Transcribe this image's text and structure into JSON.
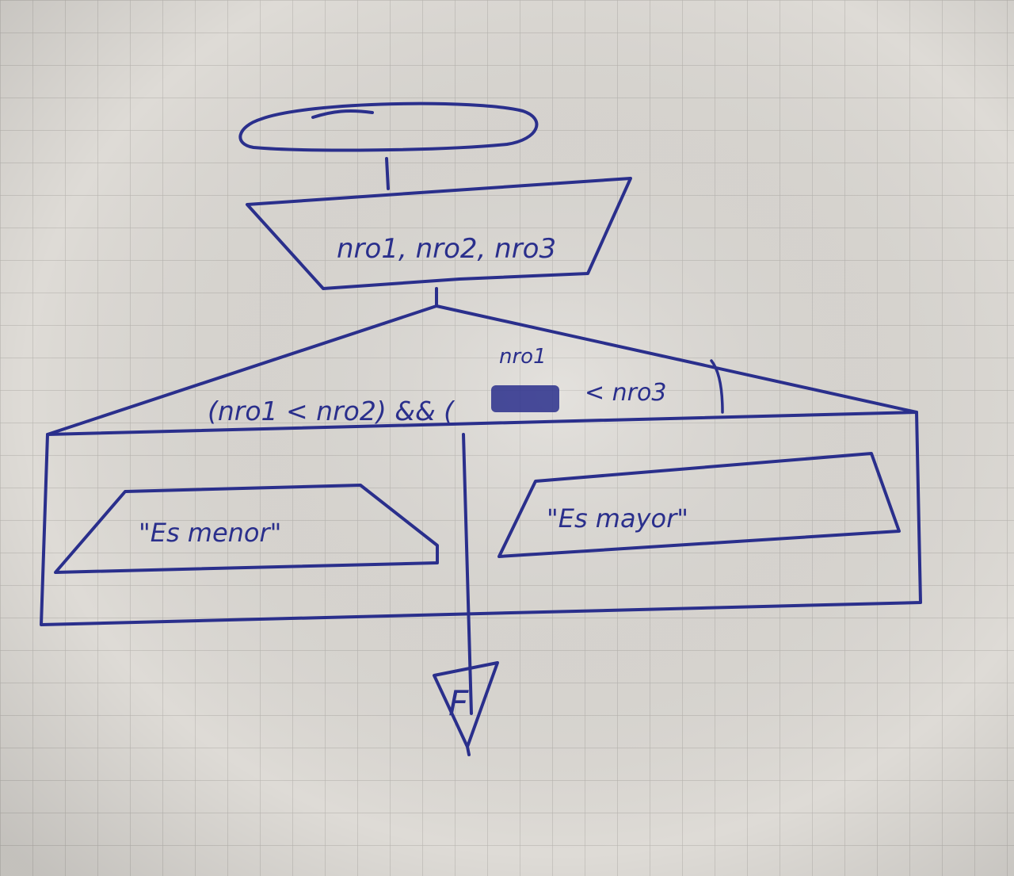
{
  "diagram": {
    "type": "handwritten-flowchart",
    "colors": {
      "paper": "#dedbd6",
      "grid": "#b9b6b1",
      "ink": "#2a2f8c"
    },
    "input": {
      "label": "nro1, nro2, nro3"
    },
    "decision": {
      "condition_main": "(nro1 < nro2) && (",
      "condition_tail": "< nro3",
      "annotation": "nro1"
    },
    "branch_left": {
      "output_text": "\"Es menor\""
    },
    "branch_right": {
      "output_text": "\"Es mayor\""
    },
    "end": {
      "label": "F"
    }
  }
}
